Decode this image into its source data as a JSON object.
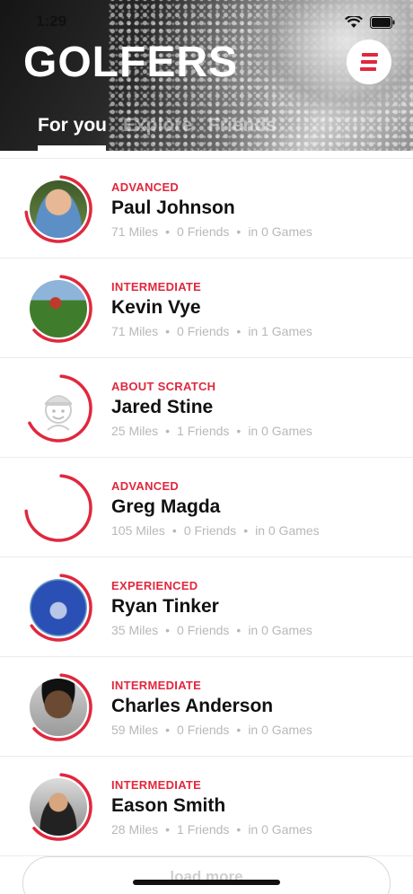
{
  "status_bar": {
    "time": "1:29"
  },
  "header": {
    "title": "GOLFERS",
    "tabs": [
      {
        "label": "For you",
        "active": true
      },
      {
        "label": "Explore",
        "active": false
      },
      {
        "label": "Friends",
        "active": false
      }
    ]
  },
  "accent_color": "#e0283e",
  "golfers": [
    {
      "level": "ADVANCED",
      "name": "Paul Johnson",
      "miles": "71 Miles",
      "friends": "0 Friends",
      "games": "in 0 Games",
      "progress": 0.72,
      "avatar": "photo"
    },
    {
      "level": "INTERMEDIATE",
      "name": "Kevin Vye",
      "miles": "71 Miles",
      "friends": "0 Friends",
      "games": "in 1 Games",
      "progress": 0.62,
      "avatar": "photo"
    },
    {
      "level": "ABOUT SCRATCH",
      "name": "Jared Stine",
      "miles": "25 Miles",
      "friends": "1 Friends",
      "games": "in 0 Games",
      "progress": 0.66,
      "avatar": "golfer-placeholder-icon"
    },
    {
      "level": "ADVANCED",
      "name": "Greg Magda",
      "miles": "105 Miles",
      "friends": "0 Friends",
      "games": "in 0 Games",
      "progress": 0.72,
      "avatar": "none"
    },
    {
      "level": "EXPERIENCED",
      "name": "Ryan Tinker",
      "miles": "35 Miles",
      "friends": "0 Friends",
      "games": "in 0 Games",
      "progress": 0.64,
      "avatar": "photo"
    },
    {
      "level": "INTERMEDIATE",
      "name": "Charles Anderson",
      "miles": "59 Miles",
      "friends": "0 Friends",
      "games": "in 0 Games",
      "progress": 0.62,
      "avatar": "photo"
    },
    {
      "level": "INTERMEDIATE",
      "name": "Eason Smith",
      "miles": "28 Miles",
      "friends": "1 Friends",
      "games": "in 0 Games",
      "progress": 0.62,
      "avatar": "photo"
    }
  ],
  "load_more_label": "load more"
}
